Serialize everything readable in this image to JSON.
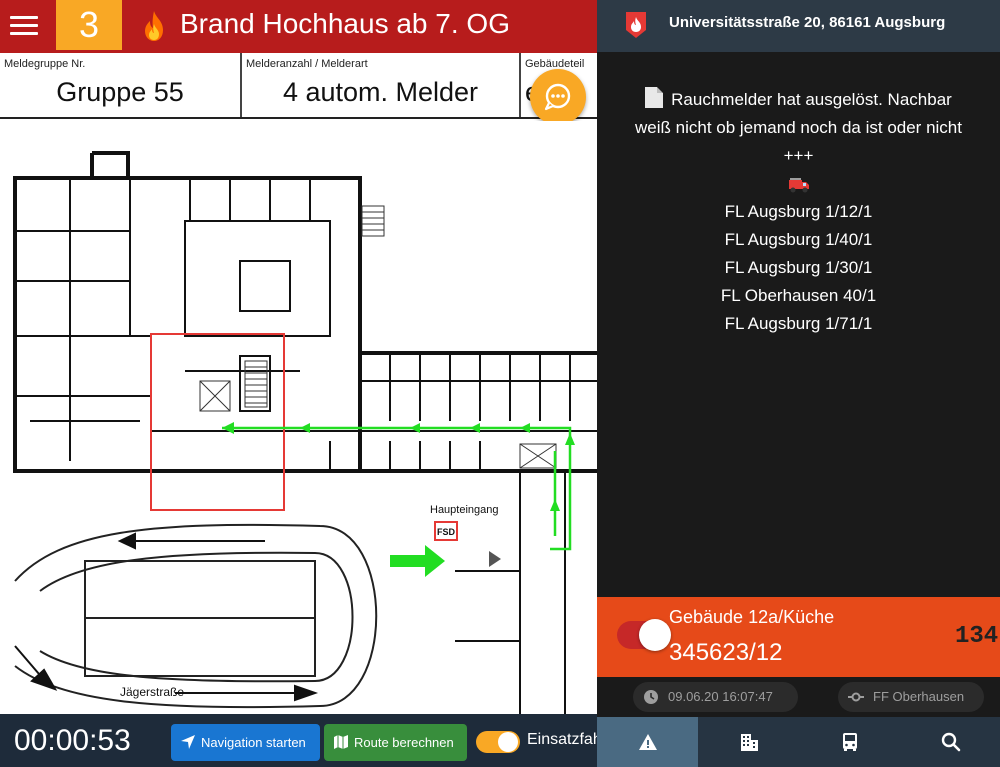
{
  "header": {
    "alarm_level": "3",
    "title": "Brand Hochhaus ab 7. OG",
    "icons": {
      "menu": "hamburger-icon",
      "fire": "fire-icon"
    }
  },
  "info": {
    "group_label": "Meldegruppe Nr.",
    "group_value": "Gruppe 55",
    "detectors_label": "Melderanzahl / Melderart",
    "detectors_value": "4 autom. Melder",
    "building_label": "Gebäudeteil",
    "building_value": "e"
  },
  "map": {
    "entrance_label": "Haupteingang",
    "fsd_label": "FSD",
    "street_label": "Jägerstraße"
  },
  "bottom": {
    "timer": "00:00:53",
    "nav_label": "Navigation starten",
    "route_label": "Route berechnen",
    "einsatz_label": "Einsatzfahrt",
    "einsatz_on": true
  },
  "right": {
    "address": "Universitätsstraße 20, 86161 Augsburg",
    "message": {
      "line1": "Rauchmelder hat ausgelöst. Nachbar",
      "line2": "weiß nicht ob jemand noch da ist oder nicht",
      "separator": "+++",
      "units": [
        "FL Augsburg 1/12/1",
        "FL Augsburg 1/40/1",
        "FL Augsburg 1/30/1",
        "FL Oberhausen 40/1",
        "FL Augsburg 1/71/1"
      ]
    },
    "object": {
      "name": "Gebäude 12a/Küche",
      "number": "345623/12",
      "extra": "134"
    },
    "meta": {
      "datetime": "09.06.20 16:07:47",
      "unit": "FF Oberhausen"
    },
    "tabs": [
      "alarm-tab",
      "building-tab",
      "vehicles-tab",
      "search-tab"
    ]
  },
  "colors": {
    "header_red": "#b71c1c",
    "accent_yellow": "#f9a825",
    "object_orange": "#e64a19",
    "nav_blue": "#1976d2",
    "route_green": "#388e3c",
    "dark_bg": "#1a1a1a",
    "route_line": "#22dd22",
    "highlight_box": "#e53935"
  }
}
